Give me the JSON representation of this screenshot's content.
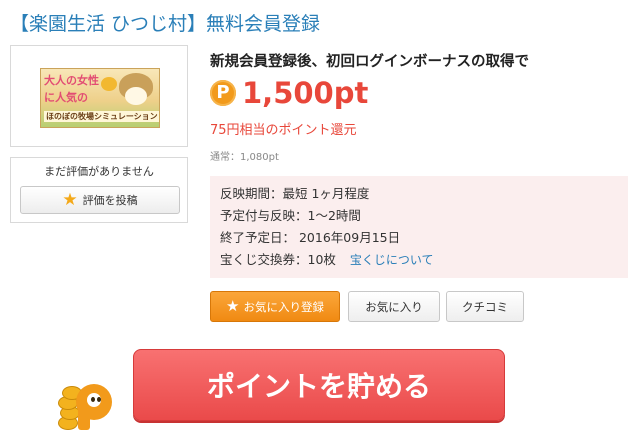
{
  "title": "【楽園生活 ひつじ村】無料会員登録",
  "banner": {
    "text_line1": "大人の女性",
    "text_line2": "に人気の",
    "text_line3": "ほのぼの牧場シミュレーション"
  },
  "review": {
    "none_text": "まだ評価がありません",
    "post_button": "評価を投稿"
  },
  "offer": {
    "headline": "新規会員登録後、初回ログインボーナスの取得で",
    "point_icon": "P",
    "points": "1,500pt",
    "yen_text": "75円相当のポイント還元",
    "normal_text": "通常：1,080pt"
  },
  "info": {
    "rows": [
      {
        "text": "反映期間：最短 1ヶ月程度"
      },
      {
        "text": "予定付与反映：1～2時間"
      },
      {
        "text": "終了予定日： 2016年09月15日"
      },
      {
        "text": "宝くじ交換券：10枚",
        "link": "宝くじについて"
      }
    ]
  },
  "buttons": {
    "favorite_register": "お気に入り登録",
    "favorites": "お気に入り",
    "reviews": "クチコミ",
    "save_points": "ポイントを貯める"
  },
  "colors": {
    "title": "#2a7fb8",
    "points": "#e8473a",
    "orange": "#f29a1b",
    "main_button": "#ea4a4a",
    "info_bg": "#fbeeee"
  },
  "icons": {
    "star": "star-icon",
    "point": "point-circle-icon",
    "mascot": "point-mascot-icon"
  }
}
